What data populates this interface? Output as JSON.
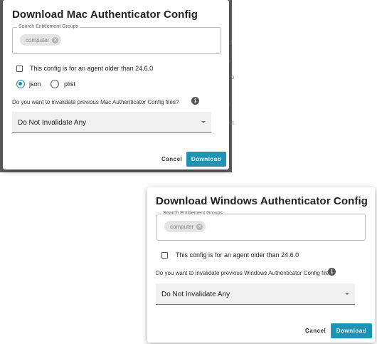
{
  "background": {
    "fragments": [
      "d",
      "r",
      "ro",
      "i",
      "pt"
    ]
  },
  "mac_dialog": {
    "title": "Download Mac Authenticator Config",
    "search_legend": "Search Entitlement Groups",
    "chip_label": "computer",
    "checkbox_label": "This config is for an agent older than 24.6.0",
    "format_options": [
      {
        "label": "json",
        "selected": true
      },
      {
        "label": "plist",
        "selected": false
      }
    ],
    "invalidate_question": "Do you want to invalidate previous Mac Authenticator Config files?",
    "invalidate_value": "Do Not Invalidate Any",
    "cancel_label": "Cancel",
    "download_label": "Download"
  },
  "windows_dialog": {
    "title": "Download Windows Authenticator Config",
    "search_legend": "Search Entitlement Groups",
    "chip_label": "computer",
    "checkbox_label": "This config is for an agent older than 24.6.0",
    "invalidate_question": "Do you want to invalidate previous Windows Authenticator Config files?",
    "invalidate_value": "Do Not Invalidate Any",
    "cancel_label": "Cancel",
    "download_label": "Download"
  },
  "colors": {
    "accent": "#1f93b4",
    "overlay": "#5f5f5f"
  }
}
